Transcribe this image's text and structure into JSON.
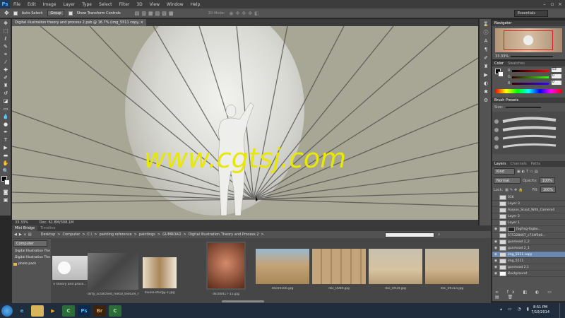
{
  "menu": {
    "app_logo": "Ps",
    "items": [
      "File",
      "Edit",
      "Image",
      "Layer",
      "Type",
      "Select",
      "Filter",
      "3D",
      "View",
      "Window",
      "Help"
    ]
  },
  "options": {
    "auto_select": "Auto-Select:",
    "group": "Group",
    "show_transform": "Show Transform Controls",
    "mode_3d": "3D Mode:",
    "workspace": "Essentials"
  },
  "document": {
    "tab_title": "Digital illustration theory and process 2.psb @ 16.7% (img_5511 copy, RGB/8) *",
    "zoom": "33.33%",
    "doc_size": "Doc: 61.8M/308.1M",
    "watermark": "www.cgtsj.com"
  },
  "navigator": {
    "title": "Navigator",
    "zoom": "33.33%"
  },
  "color": {
    "tab_color": "Color",
    "tab_swatches": "Swatches",
    "r_value": "53",
    "g_value": "0",
    "b_value": "0"
  },
  "brush_presets": {
    "title": "Brush Presets",
    "size_label": "Size:"
  },
  "layers": {
    "tab_layers": "Layers",
    "tab_channels": "Channels",
    "tab_paths": "Paths",
    "kind": "Kind",
    "blend": "Normal",
    "opacity_label": "Opacity:",
    "opacity": "100%",
    "lock_label": "Lock:",
    "fill_label": "Fill:",
    "fill": "100%",
    "rows": [
      {
        "name": "016",
        "selected": false
      },
      {
        "name": "Layer 3",
        "selected": false
      },
      {
        "name": "Aaryon_Scout_With_Camera4",
        "selected": false
      },
      {
        "name": "Layer 2",
        "selected": false
      },
      {
        "name": "Layer 1",
        "selected": false
      },
      {
        "name": "fogfrog-fogbo...",
        "selected": false
      },
      {
        "name": "575328467_c734f5b6...",
        "selected": false
      },
      {
        "name": "gunmoad 2_2",
        "selected": false
      },
      {
        "name": "gunmoad 2_1",
        "selected": false
      },
      {
        "name": "img_5511 copy",
        "selected": true
      },
      {
        "name": "img_5511",
        "selected": false
      },
      {
        "name": "gunmoad 2.1",
        "selected": false
      },
      {
        "name": "Background",
        "selected": false
      }
    ]
  },
  "bridge": {
    "tab_mini_bridge": "Mini Bridge",
    "tab_timeline": "Timeline",
    "path": [
      "Desktop",
      "Computer",
      "C:\\",
      "painting reference",
      "paintings",
      "GUMROAD",
      "Digital Illustration Theory and Process 2"
    ],
    "side_label": "Computer",
    "favorites": [
      "Digital Illustration The",
      "Digital Illustration The",
      "photo pack"
    ],
    "thumbnails": [
      {
        "caption": "n theory and proce...",
        "color": "#e8e8e8"
      },
      {
        "caption": "dirty_scratched_metal_texture_full_d...",
        "color": "#5b5b5b"
      },
      {
        "caption": "divine-liturgy-1.jpg",
        "color": "#c9a27a"
      },
      {
        "caption": "dsc00417-15.jpg",
        "color": "#8a3a2a"
      },
      {
        "caption": "dsc04166.jpg",
        "color": "#b79a6a"
      },
      {
        "caption": "dsc_0089.jpg",
        "color": "#c4a47a"
      },
      {
        "caption": "dsc_0919.jpg",
        "color": "#d7c3a0"
      },
      {
        "caption": "dsc_0931a.jpg",
        "color": "#cdb48e"
      }
    ]
  },
  "taskbar": {
    "time": "8:51 PM",
    "date": "7/10/2014"
  }
}
